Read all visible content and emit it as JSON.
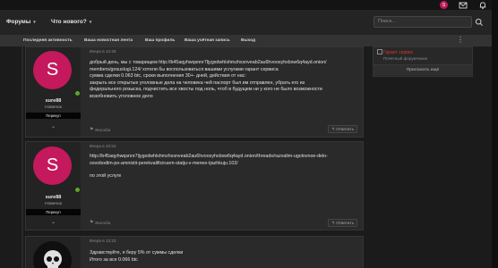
{
  "topbar": {
    "avatar_letter": "S",
    "icons": [
      "avatar",
      "mail-icon",
      "bell-icon"
    ]
  },
  "nav": {
    "forums_label": "Форумы",
    "whats_new_label": "Что нового?",
    "search_placeholder": "Поиск..."
  },
  "subnav": {
    "items": [
      "Последняя активность",
      "Ваша новостная лента",
      "Ваш профиль",
      "Ваша учётная запись",
      "Выход"
    ]
  },
  "sidebar_widget": {
    "title": "Гарант сервис",
    "subtitle": "Почётный форумчанин",
    "invite_label": "Пригласить ещё"
  },
  "posts": [
    {
      "avatar_letter": "S",
      "username": "sure88",
      "user_title": "Новичок",
      "banner": "Перекуп",
      "date": "Вчера в 10:28",
      "body": [
        "добрый день, мы с товарищем http://b45aqyhwqsnnr7ljygxdwhlshmzhxsnveab2au6hvoosyhxbxw6q4ayd.onion/",
        "members/gosuslugi.124/ хотели бы воспользоваться вашими услугами гарант сервиса",
        "сумма сделки 0.063 btc, сроки выполнения 30+- дней, действия от нас:",
        "закрыть все открытые уголовные дела на человека чей паспорт был им отправлен, убрать его из",
        "федерального розыска, подчистить все хвосты под ноль, чтоб в будущем ни у кого не было возможности",
        "возобновить уголовное дело"
      ],
      "report_label": "Жалоба",
      "reply_label": "Ответить"
    },
    {
      "avatar_letter": "S",
      "username": "sure88",
      "user_title": "Новичок",
      "banner": "Перекуп",
      "date": "Вчера в 10:53",
      "body": [
        "http://b45aqyhwqsnnr7ljygxdwhlshmzhxsnveab2au6hvoosyhxbxw6q4ayd.onion/threads/razvalim-ugolovnoe-delo-",
        "osvobodim-po-amnistii-perekvalificiruem-statju-v-menee-tjazhkuju.102/",
        "",
        "по этой услуге"
      ],
      "report_label": "Жалоба",
      "reply_label": "Ответить"
    },
    {
      "date": "Вчера в 13:23",
      "body": [
        "Здравствуйте, я беру 5% от суммы сделки",
        "Итого за все 0.066 btc"
      ]
    }
  ],
  "colors": {
    "avatar": "#c4195c",
    "online": "#5aa825",
    "accent_red": "#dd3333"
  }
}
